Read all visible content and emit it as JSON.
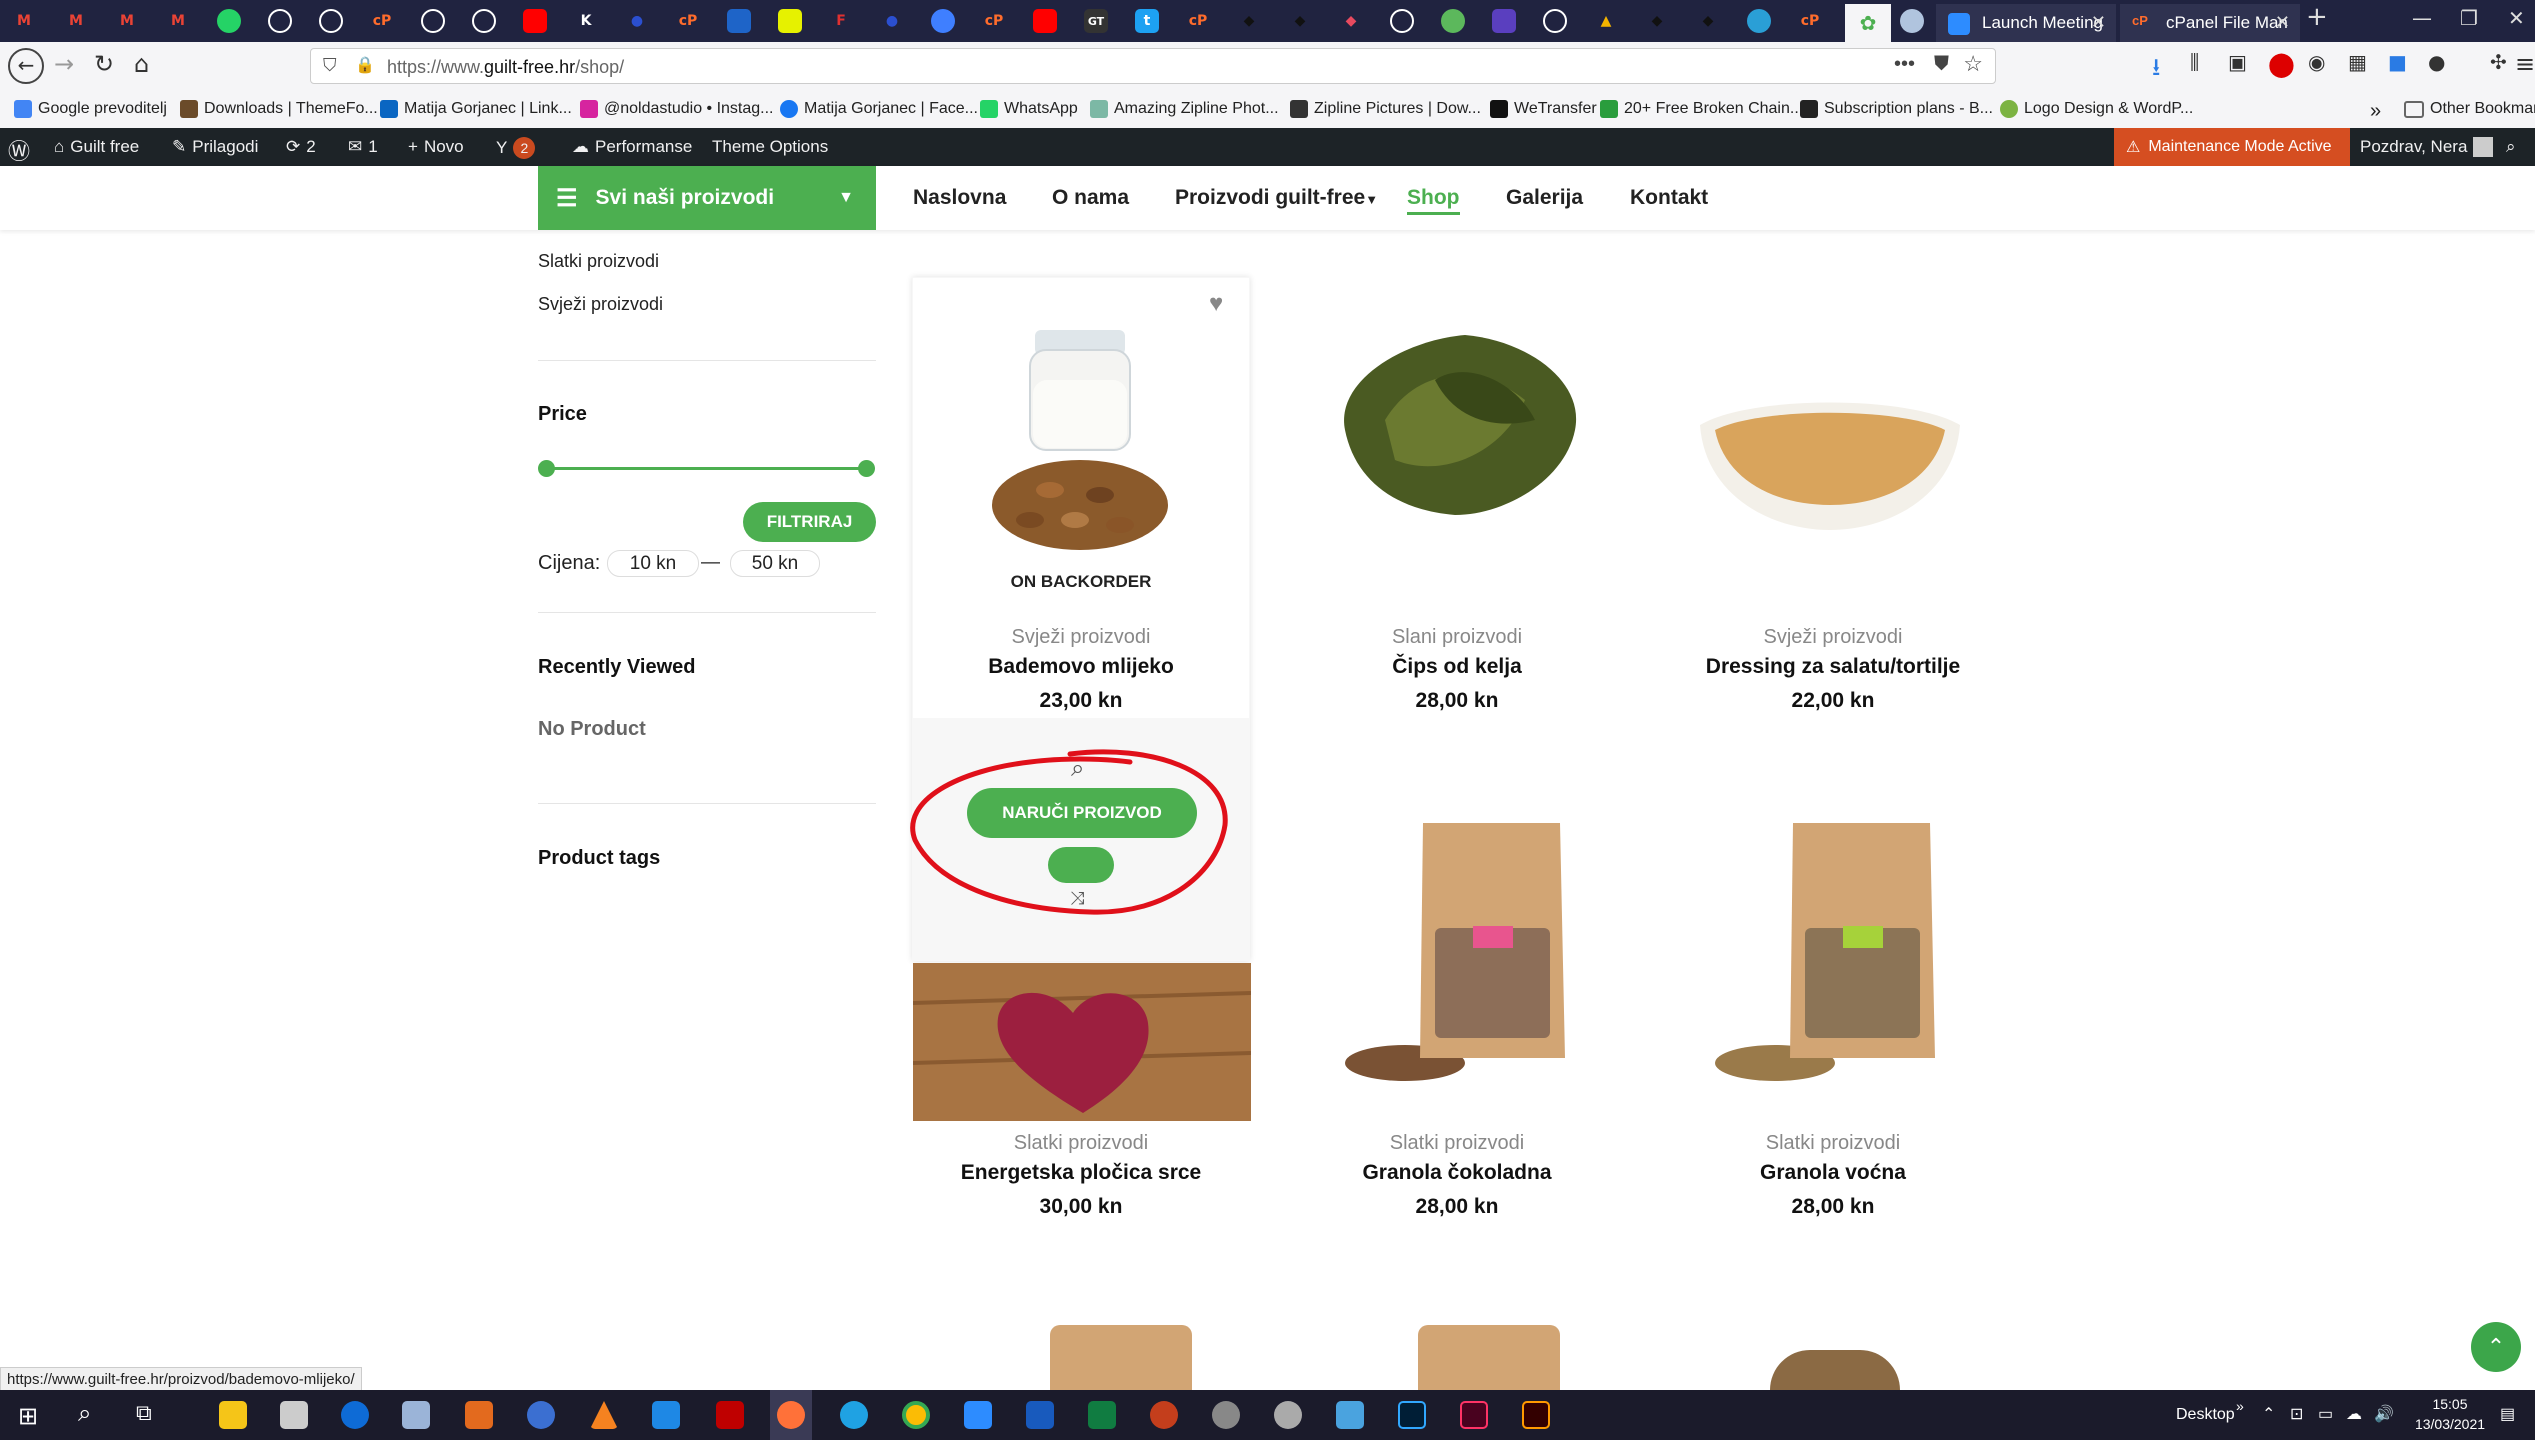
{
  "browser": {
    "tabs": [
      {
        "label": "Launch Meeting"
      },
      {
        "label": "cPanel File Man"
      }
    ],
    "url_prefix": "https://www.",
    "url_domain": "guilt-free.hr",
    "url_path": "/shop/",
    "bookmarks": [
      "Google prevoditelj",
      "Downloads | ThemeFo...",
      "Matija Gorjanec | Link...",
      "@noldastudio • Instag...",
      "Matija Gorjanec | Face...",
      "WhatsApp",
      "Amazing Zipline Phot...",
      "Zipline Pictures | Dow...",
      "WeTransfer",
      "20+ Free Broken Chain...",
      "Subscription plans - B...",
      "Logo Design & WordP..."
    ],
    "other_bookmarks": "Other Bookmarks",
    "status_url": "https://www.guilt-free.hr/proizvod/bademovo-mlijeko/",
    "accent": "#4caf50"
  },
  "wpadmin": {
    "site": "Guilt free",
    "customize": "Prilagodi",
    "updates": "2",
    "comments": "1",
    "new": "Novo",
    "yoast_count": "2",
    "performance": "Performanse",
    "theme_options": "Theme Options",
    "maintenance": "Maintenance Mode Active",
    "greeting": "Pozdrav, Nera"
  },
  "header": {
    "categories_button": "Svi naši proizvodi",
    "menu": [
      "Naslovna",
      "O nama",
      "Proizvodi guilt-free",
      "Shop",
      "Galerija",
      "Kontakt"
    ]
  },
  "sidebar": {
    "categories": [
      "Slatki proizvodi",
      "Svježi proizvodi"
    ],
    "price_heading": "Price",
    "price_min": 10,
    "price_max": 50,
    "filter_button": "FILTRIRAJ",
    "price_label": "Cijena:",
    "price_from": "10 kn",
    "price_dash": "—",
    "price_to": "50 kn",
    "recently_heading": "Recently Viewed",
    "no_product": "No Product",
    "tags_heading": "Product tags"
  },
  "products": [
    {
      "category": "Svježi proizvodi",
      "name": "Bademovo mlijeko",
      "price": "23,00 kn",
      "badge": "ON BACKORDER"
    },
    {
      "category": "Slani proizvodi",
      "name": "Čips od kelja",
      "price": "28,00 kn"
    },
    {
      "category": "Svježi proizvodi",
      "name": "Dressing za salatu/tortilje",
      "price": "22,00 kn"
    },
    {
      "category": "Slatki proizvodi",
      "name": "Energetska pločica srce",
      "price": "30,00 kn"
    },
    {
      "category": "Slatki proizvodi",
      "name": "Granola čokoladna",
      "price": "28,00 kn"
    },
    {
      "category": "Slatki proizvodi",
      "name": "Granola voćna",
      "price": "28,00 kn"
    }
  ],
  "hover": {
    "order_button": "NARUČI PROIZVOD"
  },
  "taskbar": {
    "desktop_label": "Desktop",
    "time": "15:05",
    "date": "13/03/2021"
  }
}
